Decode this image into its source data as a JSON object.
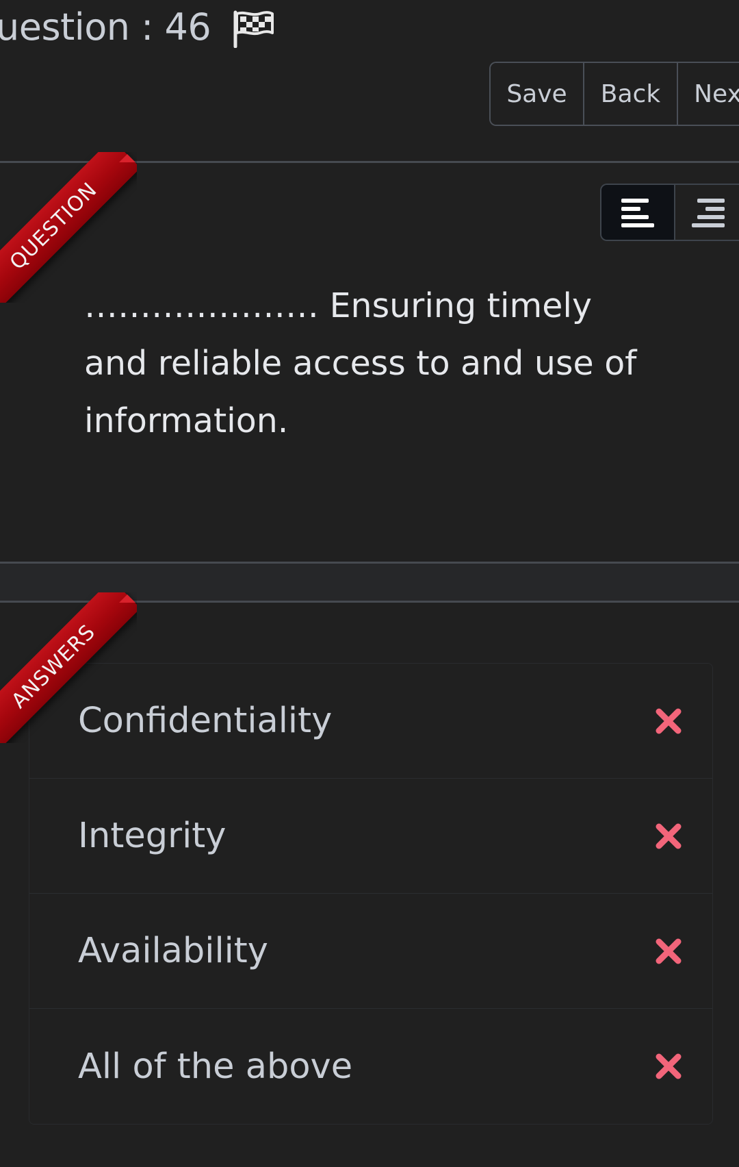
{
  "header": {
    "title": "uestion : 46",
    "flag_icon": "flag-icon"
  },
  "toolbar": {
    "save_label": "Save",
    "back_label": "Back",
    "next_label": "Nex"
  },
  "question_section": {
    "ribbon_label": "QUESTION",
    "align_left_icon": "align-left-icon",
    "align_right_icon": "align-right-icon",
    "text": "………………… Ensuring timely and reliable access to and use of information."
  },
  "answers_section": {
    "ribbon_label": "ANSWERS",
    "status_icon": "x-icon",
    "status_color": "#f2657a",
    "items": [
      {
        "label": "Confidentiality"
      },
      {
        "label": "Integrity"
      },
      {
        "label": "Availability"
      },
      {
        "label": "All of the above"
      }
    ]
  },
  "colors": {
    "background": "#202020",
    "ribbon": "#b00b12",
    "text": "#c9ced6"
  }
}
